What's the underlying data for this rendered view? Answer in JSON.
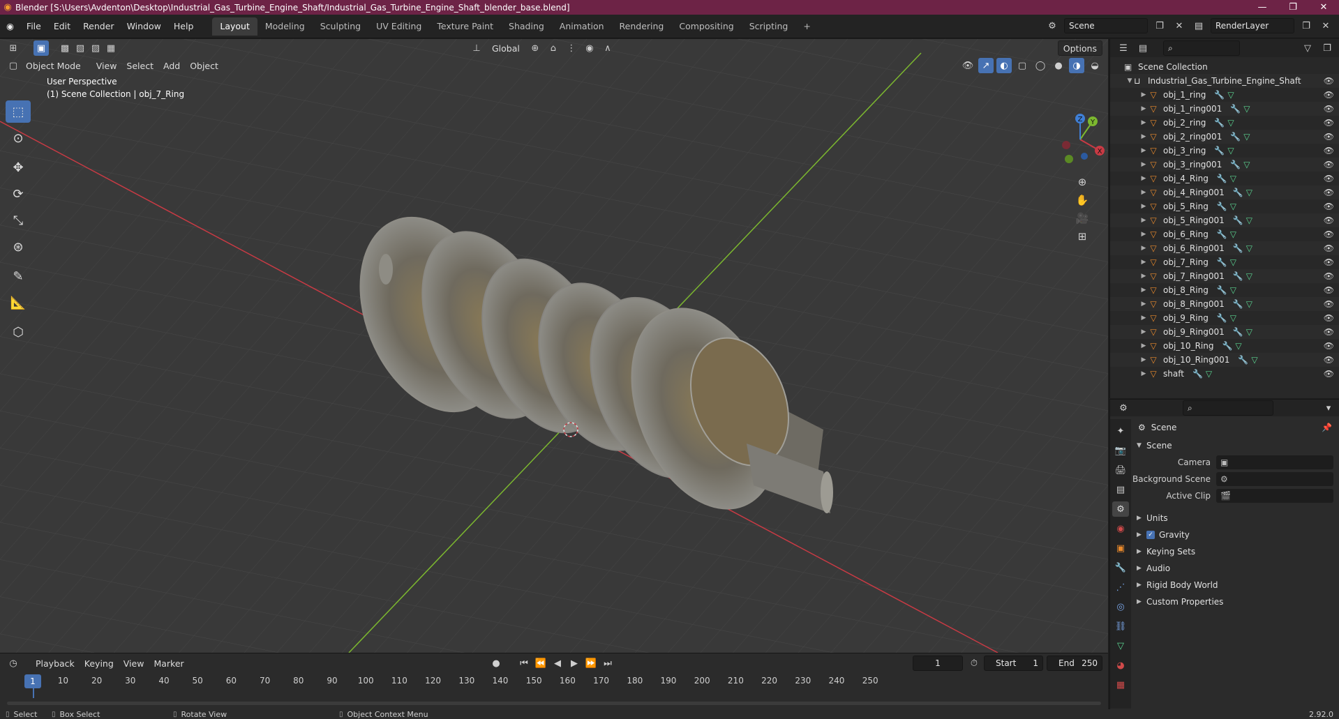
{
  "window": {
    "title": "Blender [S:\\Users\\Avdenton\\Desktop\\Industrial_Gas_Turbine_Engine_Shaft/Industrial_Gas_Turbine_Engine_Shaft_blender_base.blend]",
    "minimize": "—",
    "restore": "❐",
    "close": "✕"
  },
  "menubar": {
    "items": [
      "File",
      "Edit",
      "Render",
      "Window",
      "Help"
    ],
    "workspaces": [
      "Layout",
      "Modeling",
      "Sculpting",
      "UV Editing",
      "Texture Paint",
      "Shading",
      "Animation",
      "Rendering",
      "Compositing",
      "Scripting"
    ],
    "add_workspace": "+",
    "scene_name": "Scene",
    "render_layer": "RenderLayer"
  },
  "viewport": {
    "transform_orientation": "Global",
    "options_label": "Options",
    "mode": "Object Mode",
    "menus": [
      "View",
      "Select",
      "Add",
      "Object"
    ],
    "perspective": "User Perspective",
    "collection_info": "(1) Scene Collection | obj_7_Ring",
    "gizmo": {
      "x": "X",
      "y": "Y",
      "z": "Z"
    }
  },
  "timeline": {
    "menus": [
      "Playback",
      "Keying",
      "View",
      "Marker"
    ],
    "current_frame": "1",
    "start_label": "Start",
    "start": "1",
    "end_label": "End",
    "end": "250",
    "ruler": [
      "1",
      "10",
      "20",
      "30",
      "40",
      "50",
      "60",
      "70",
      "80",
      "90",
      "100",
      "110",
      "120",
      "130",
      "140",
      "150",
      "160",
      "170",
      "180",
      "190",
      "200",
      "210",
      "220",
      "230",
      "240",
      "250"
    ]
  },
  "statusbar": {
    "select": "Select",
    "box_select": "Box Select",
    "rotate_view": "Rotate View",
    "context_menu": "Object Context Menu",
    "version": "2.92.0"
  },
  "outliner": {
    "root": "Scene Collection",
    "collection": "Industrial_Gas_Turbine_Engine_Shaft",
    "objects": [
      "obj_1_ring",
      "obj_1_ring001",
      "obj_2_ring",
      "obj_2_ring001",
      "obj_3_ring",
      "obj_3_ring001",
      "obj_4_Ring",
      "obj_4_Ring001",
      "obj_5_Ring",
      "obj_5_Ring001",
      "obj_6_Ring",
      "obj_6_Ring001",
      "obj_7_Ring",
      "obj_7_Ring001",
      "obj_8_Ring",
      "obj_8_Ring001",
      "obj_9_Ring",
      "obj_9_Ring001",
      "obj_10_Ring",
      "obj_10_Ring001",
      "shaft"
    ]
  },
  "properties": {
    "context": "Scene",
    "panel_title": "Scene",
    "fields": [
      {
        "label": "Camera",
        "value": ""
      },
      {
        "label": "Background Scene",
        "value": ""
      },
      {
        "label": "Active Clip",
        "value": ""
      }
    ],
    "sections": [
      "Units",
      "Gravity",
      "Keying Sets",
      "Audio",
      "Rigid Body World",
      "Custom Properties"
    ]
  },
  "colors": {
    "accent": "#4772b3",
    "titlebar": "#6d2346",
    "viewport_bg": "#393939",
    "x_axis": "#c83a44",
    "y_axis": "#7cb82f"
  }
}
